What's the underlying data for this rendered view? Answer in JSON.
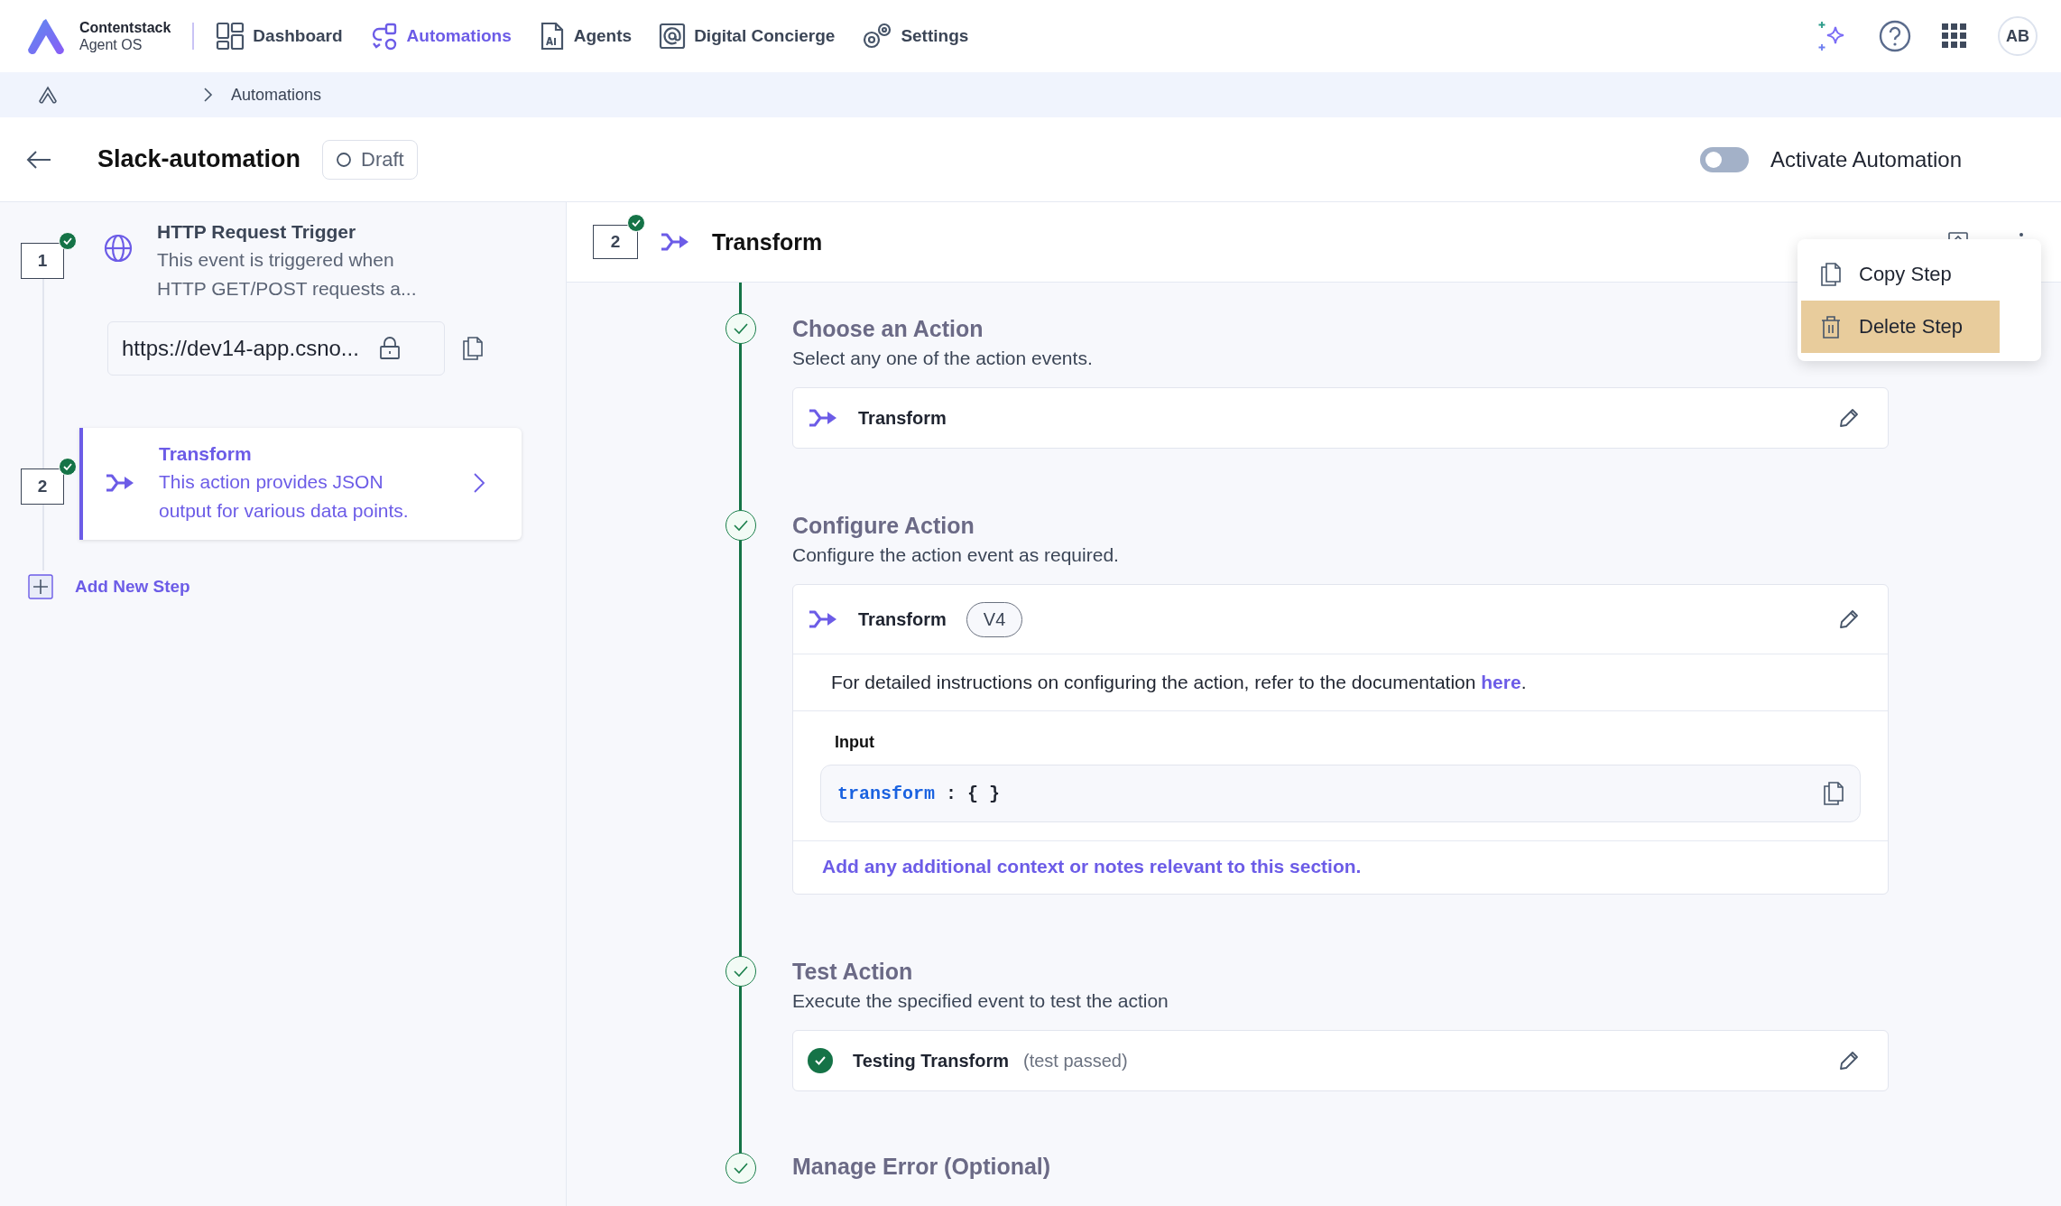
{
  "nav": {
    "brand_name": "Contentstack",
    "brand_sub": "Agent OS",
    "items": [
      {
        "label": "Dashboard",
        "kind": "dashboard",
        "selected": false
      },
      {
        "label": "Automations",
        "kind": "automations",
        "selected": true
      },
      {
        "label": "Agents",
        "kind": "agents",
        "selected": false
      },
      {
        "label": "Digital Concierge",
        "kind": "concierge",
        "selected": false
      },
      {
        "label": "Settings",
        "kind": "settings",
        "selected": false
      }
    ],
    "avatar": "AB"
  },
  "breadcrumb": {
    "current": "Automations"
  },
  "header": {
    "title": "Slack-automation",
    "status": "Draft",
    "activate_label": "Activate Automation",
    "activate_on": false
  },
  "steps": [
    {
      "number": "1",
      "kind": "trigger",
      "done": true,
      "selected": false,
      "title": "HTTP Request Trigger",
      "description": "This event is triggered when HTTP GET/POST requests a...",
      "url": "https://dev14-app.csno..."
    },
    {
      "number": "2",
      "kind": "action",
      "done": true,
      "selected": true,
      "title": "Transform",
      "description": "This action provides JSON output for various data points."
    }
  ],
  "add_step": "Add New Step",
  "detail": {
    "number": "2",
    "done": true,
    "title": "Transform",
    "sections": [
      {
        "kind": "choose",
        "done": true,
        "title": "Choose an Action",
        "subtitle": "Select any one of the action events.",
        "action": "Transform"
      },
      {
        "kind": "configure",
        "done": true,
        "title": "Configure Action",
        "subtitle": "Configure the action event as required.",
        "action": "Transform",
        "version": "V4",
        "instructions": "For detailed instructions on configuring the action, refer to the documentation",
        "link": "here",
        "instructions_end": ".",
        "input_label": "Input",
        "code_key": "transform",
        "code_value": ": { }",
        "notes": "Add any additional context or notes relevant to this section."
      },
      {
        "kind": "test",
        "done": true,
        "title": "Test Action",
        "subtitle": "Execute the specified event to test the action",
        "test_name": "Testing Transform",
        "result": "(test passed)",
        "passed": true
      },
      {
        "kind": "error",
        "done": true,
        "title": "Manage Error (Optional)"
      }
    ]
  },
  "menu": [
    {
      "label": "Copy Step",
      "kind": "copy",
      "selected": false
    },
    {
      "label": "Delete Step",
      "kind": "delete",
      "selected": true
    }
  ]
}
